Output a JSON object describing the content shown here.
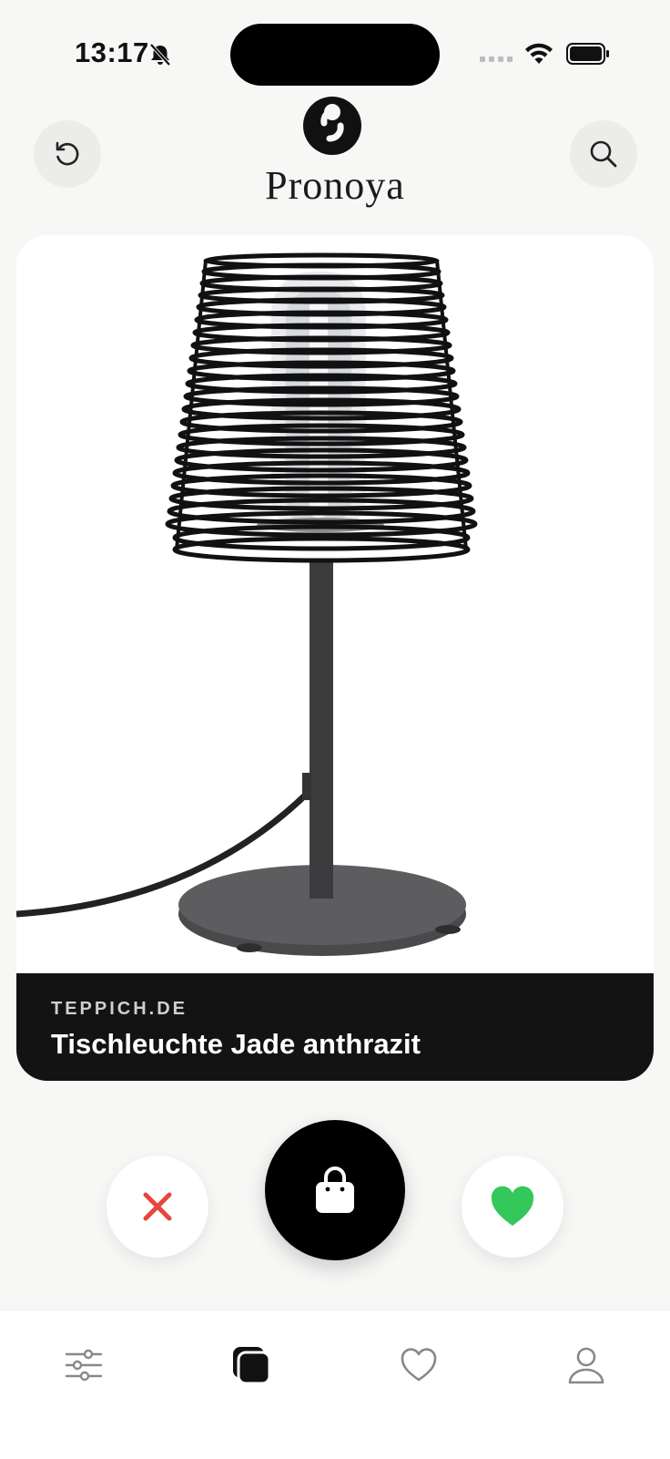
{
  "status_bar": {
    "time": "13:17",
    "icons": [
      "bell-slash-icon",
      "signal-icon",
      "wifi-icon",
      "battery-icon"
    ]
  },
  "header": {
    "brand": "Pronoya",
    "left_button_icon": "refresh-icon",
    "right_button_icon": "search-icon"
  },
  "card": {
    "shop": "TEPPICH.DE",
    "title": "Tischleuchte Jade anthrazit",
    "image": "black wire table lamp"
  },
  "actions": {
    "dislike_icon": "close-icon",
    "buy_icon": "shopping-bag-icon",
    "like_icon": "heart-icon"
  },
  "tabs": [
    {
      "icon": "sliders-icon",
      "active": false
    },
    {
      "icon": "cards-icon",
      "active": true
    },
    {
      "icon": "heart-outline-icon",
      "active": false
    },
    {
      "icon": "user-icon",
      "active": false
    }
  ],
  "colors": {
    "background": "#f7f7f6",
    "dislike": "#e8453c",
    "like": "#34c759",
    "card_footer": "#131313"
  }
}
